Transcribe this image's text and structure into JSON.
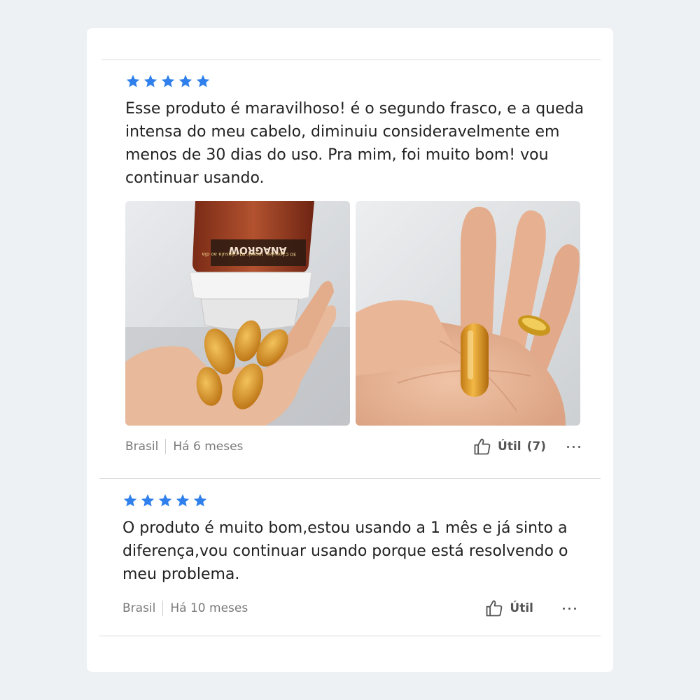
{
  "reviews": [
    {
      "rating": 5,
      "text": "Esse produto é maravilhoso! é o segundo frasco, e a queda intensa do meu cabelo, diminuiu consideravelmente em menos de 30 dias do uso. Pra mim, foi muito bom! vou continuar usando.",
      "photos": [
        {
          "label": "ANAGROW",
          "cap_left": "30 Cápsulas",
          "cap_right": "Ingerir 01 cápsula ao dia"
        },
        {}
      ],
      "country": "Brasil",
      "time": "Há 6 meses",
      "useful_label": "Útil",
      "useful_count": "(7)"
    },
    {
      "rating": 5,
      "text": "O produto é muito bom,estou usando a 1 mês e já sinto a diferença,vou continuar usando porque está resolvendo o meu problema.",
      "country": "Brasil",
      "time": "Há 10 meses",
      "useful_label": "Útil"
    }
  ],
  "colors": {
    "star": "#2f80ed",
    "background": "#eef1f4",
    "card": "#ffffff"
  },
  "icons": [
    "star-icon",
    "thumbs-up-icon",
    "more-dots-icon"
  ]
}
